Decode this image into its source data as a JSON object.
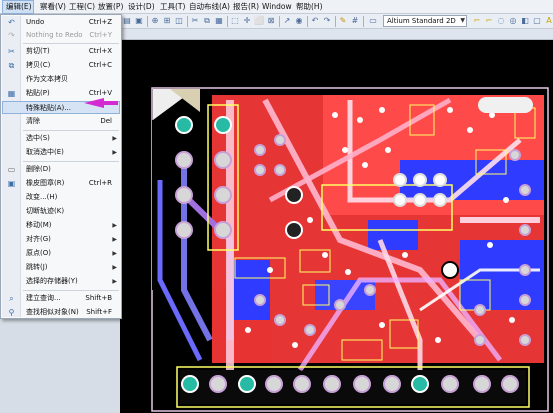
{
  "menubar": {
    "items": [
      {
        "label": "编辑(E)",
        "active": true
      },
      {
        "label": "察看(V)"
      },
      {
        "label": "工程(C)"
      },
      {
        "label": "放置(P)"
      },
      {
        "label": "设计(D)"
      },
      {
        "label": "工具(T)"
      },
      {
        "label": "自动布线(A)"
      },
      {
        "label": "报告(R)"
      },
      {
        "label": "Window"
      },
      {
        "label": "帮助(H)"
      }
    ]
  },
  "toolbar": {
    "layer_select_value": "Altium Standard 2D"
  },
  "edit_menu": {
    "items": [
      {
        "label": "Undo",
        "shortcut": "Ctrl+Z",
        "icon": "undo-icon",
        "disabled": false
      },
      {
        "label": "Nothing to Redo",
        "shortcut": "Ctrl+Y",
        "icon": "redo-icon",
        "disabled": true
      },
      {
        "label": "剪切(T)",
        "shortcut": "Ctrl+X",
        "icon": "cut-icon"
      },
      {
        "label": "拷贝(C)",
        "shortcut": "Ctrl+C",
        "icon": "copy-icon"
      },
      {
        "label": "作为文本拷贝",
        "shortcut": "",
        "icon": ""
      },
      {
        "label": "粘贴(P)",
        "shortcut": "Ctrl+V",
        "icon": "paste-icon"
      },
      {
        "label": "特殊粘贴(A)...",
        "shortcut": "",
        "icon": "",
        "highlighted": true
      },
      {
        "label": "清除",
        "shortcut": "Del",
        "icon": ""
      },
      {
        "label": "选中(S)",
        "shortcut": "",
        "icon": "",
        "submenu": true
      },
      {
        "label": "取消选中(E)",
        "shortcut": "",
        "icon": "",
        "submenu": true
      },
      {
        "label": "删除(D)",
        "shortcut": "",
        "icon": "delete-icon"
      },
      {
        "label": "橡皮图章(R)",
        "shortcut": "Ctrl+R",
        "icon": "rubber-stamp-icon"
      },
      {
        "label": "改变...(H)",
        "shortcut": "",
        "icon": ""
      },
      {
        "label": "切断轨迹(K)",
        "shortcut": "",
        "icon": ""
      },
      {
        "label": "移动(M)",
        "shortcut": "",
        "icon": "",
        "submenu": true
      },
      {
        "label": "对齐(G)",
        "shortcut": "",
        "icon": "",
        "submenu": true
      },
      {
        "label": "原点(O)",
        "shortcut": "",
        "icon": "",
        "submenu": true
      },
      {
        "label": "跳转(J)",
        "shortcut": "",
        "icon": "",
        "submenu": true
      },
      {
        "label": "选择的存储器(Y)",
        "shortcut": "",
        "icon": "",
        "submenu": true
      },
      {
        "label": "建立查询...",
        "shortcut": "Shift+B",
        "icon": "query-icon"
      },
      {
        "label": "查找相似对象(N)",
        "shortcut": "Shift+F",
        "icon": "find-similar-icon"
      }
    ]
  },
  "colors": {
    "top_layer": "#ff3b3b",
    "bottom_layer": "#2f3bff",
    "silkscreen": "#ffff66",
    "pad": "#d7d7d7",
    "canvas": "#000000",
    "annotation_arrow": "#d42ad4"
  }
}
